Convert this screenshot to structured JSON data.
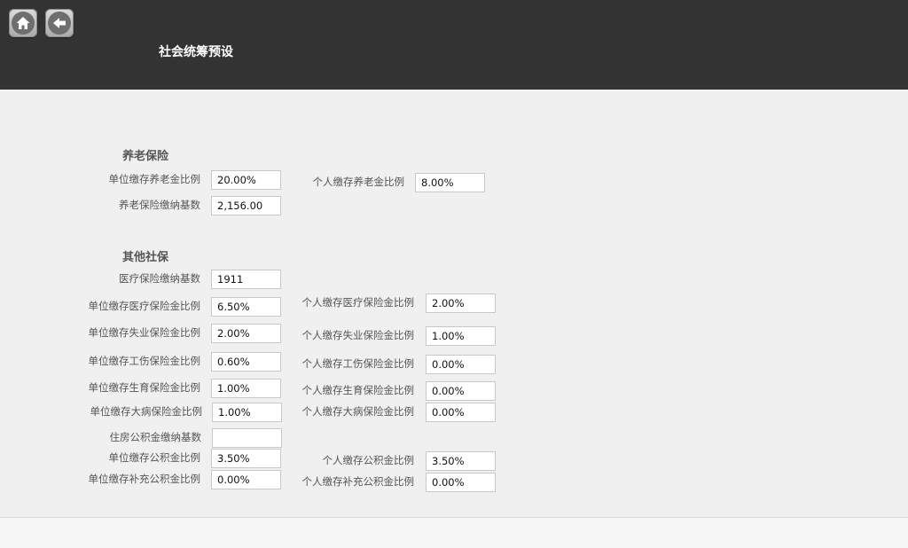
{
  "header": {
    "title": "社会统筹预设",
    "home_icon": "home-icon",
    "back_icon": "back-arrow-icon"
  },
  "pension": {
    "section_title": "养老保险",
    "employer_rate_label": "单位缴存养老金比例",
    "employer_rate_value": "20.00%",
    "personal_rate_label": "个人缴存养老金比例",
    "personal_rate_value": "8.00%",
    "base_label": "养老保险缴纳基数",
    "base_value": "2,156.00"
  },
  "other": {
    "section_title": "其他社保",
    "medical_base_label": "医疗保险缴纳基数",
    "medical_base_value": "1911",
    "employer_medical_label": "单位缴存医疗保险金比例",
    "employer_medical_value": "6.50%",
    "personal_medical_label": "个人缴存医疗保险金比例",
    "personal_medical_value": "2.00%",
    "employer_unemployment_label": "单位缴存失业保险金比例",
    "employer_unemployment_value": "2.00%",
    "personal_unemployment_label": "个人缴存失业保险金比例",
    "personal_unemployment_value": "1.00%",
    "employer_injury_label": "单位缴存工伤保险金比例",
    "employer_injury_value": "0.60%",
    "personal_injury_label": "个人缴存工伤保险金比例",
    "personal_injury_value": "0.00%",
    "employer_maternity_label": "单位缴存生育保险金比例",
    "employer_maternity_value": "1.00%",
    "personal_maternity_label": "个人缴存生育保险金比例",
    "personal_maternity_value": "0.00%",
    "employer_critical_label": "单位缴存大病保险金比例",
    "employer_critical_value": "1.00%",
    "personal_critical_label": "个人缴存大病保险金比例",
    "personal_critical_value": "0.00%",
    "housing_base_label": "住房公积金缴纳基数",
    "housing_base_value": "",
    "employer_housing_label": "单位缴存公积金比例",
    "employer_housing_value": "3.50%",
    "personal_housing_label": "个人缴存公积金比例",
    "personal_housing_value": "3.50%",
    "employer_supp_housing_label": "单位缴存补充公积金比例",
    "employer_supp_housing_value": "0.00%",
    "personal_supp_housing_label": "个人缴存补充公积金比例",
    "personal_supp_housing_value": "0.00%"
  }
}
